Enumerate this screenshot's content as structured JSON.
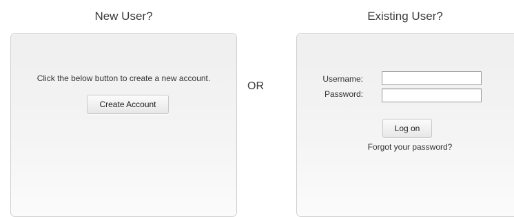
{
  "new_user": {
    "heading": "New User?",
    "description": "Click the below button to create a new account.",
    "create_button_label": "Create Account"
  },
  "separator": {
    "label": "OR"
  },
  "existing_user": {
    "heading": "Existing User?",
    "username_label": "Username:",
    "username_value": "",
    "password_label": "Password:",
    "password_value": "",
    "logon_button_label": "Log on",
    "forgot_password_link": "Forgot your password?"
  }
}
